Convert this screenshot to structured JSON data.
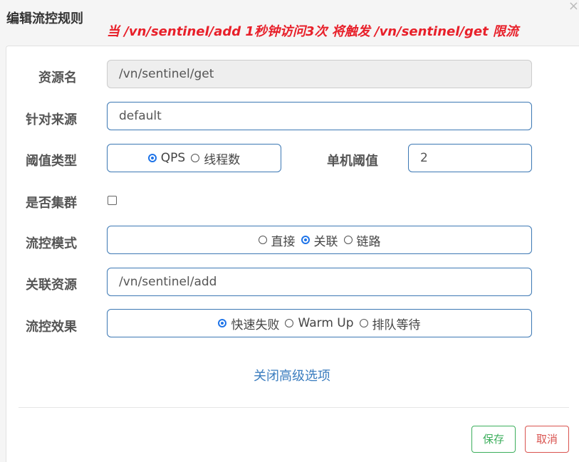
{
  "dialog": {
    "title": "编辑流控规则",
    "annotation": "当  /vn/sentinel/add  1秒钟访问3次  将触发  /vn/sentinel/get  限流",
    "close": "×"
  },
  "form": {
    "resource_name": {
      "label": "资源名",
      "value": "/vn/sentinel/get"
    },
    "limit_app": {
      "label": "针对来源",
      "value": "default"
    },
    "threshold_type": {
      "label": "阈值类型",
      "options": [
        "QPS",
        "线程数"
      ],
      "selected": "QPS"
    },
    "single_threshold": {
      "label": "单机阈值",
      "value": "2"
    },
    "cluster": {
      "label": "是否集群",
      "checked": false
    },
    "strategy": {
      "label": "流控模式",
      "options": [
        "直接",
        "关联",
        "链路"
      ],
      "selected": "关联"
    },
    "ref_resource": {
      "label": "关联资源",
      "value": "/vn/sentinel/add"
    },
    "control_behavior": {
      "label": "流控效果",
      "options": [
        "快速失败",
        "Warm Up",
        "排队等待"
      ],
      "selected": "快速失败"
    }
  },
  "advanced_toggle": "关闭高级选项",
  "buttons": {
    "save": "保存",
    "cancel": "取消"
  }
}
